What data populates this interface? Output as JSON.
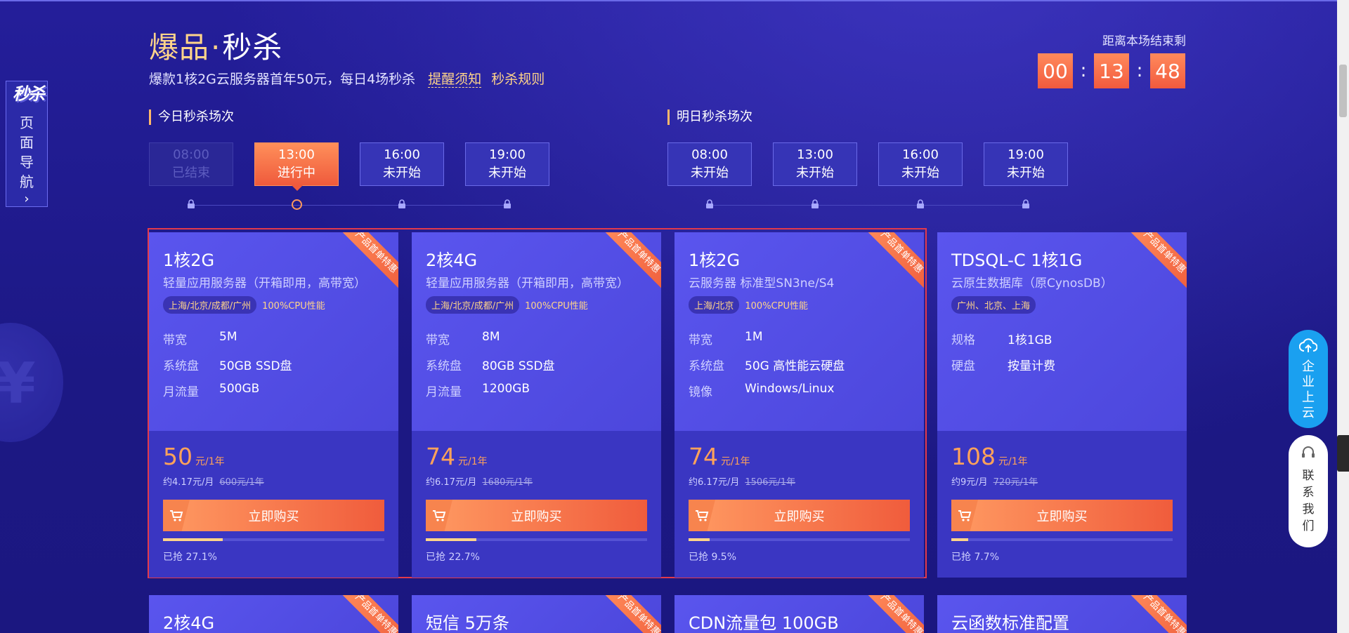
{
  "header": {
    "title_main": "爆品",
    "title_dot": "·",
    "title_sub": "秒杀",
    "subtitle": "爆款1核2G云服务器首年50元，每日4场秒杀",
    "link_remind": "提醒须知",
    "link_rules": "秒杀规则"
  },
  "side_nav": {
    "badge": "秒杀",
    "chars": [
      "页",
      "面",
      "导",
      "航"
    ],
    "chevron": "›"
  },
  "countdown": {
    "label": "距离本场结束剩",
    "hours": "00",
    "minutes": "13",
    "seconds": "48",
    "sep": ":"
  },
  "today": {
    "label": "今日秒杀场次",
    "sessions": [
      {
        "time": "08:00",
        "status": "已结束",
        "state": "ended"
      },
      {
        "time": "13:00",
        "status": "进行中",
        "state": "active"
      },
      {
        "time": "16:00",
        "status": "未开始",
        "state": "upcoming"
      },
      {
        "time": "19:00",
        "status": "未开始",
        "state": "upcoming"
      }
    ]
  },
  "tomorrow": {
    "label": "明日秒杀场次",
    "sessions": [
      {
        "time": "08:00",
        "status": "未开始",
        "state": "upcoming"
      },
      {
        "time": "13:00",
        "status": "未开始",
        "state": "upcoming"
      },
      {
        "time": "16:00",
        "status": "未开始",
        "state": "upcoming"
      },
      {
        "time": "19:00",
        "status": "未开始",
        "state": "upcoming"
      }
    ]
  },
  "products": [
    {
      "ribbon": "产品首单特惠",
      "name": "1核2G",
      "desc": "轻量应用服务器（开箱即用，高带宽）",
      "tag": "上海/北京/成都/广州",
      "tag2": "100%CPU性能",
      "specs": [
        [
          "带宽",
          "5M"
        ],
        [
          "系统盘",
          "50GB SSD盘"
        ],
        [
          "月流量",
          "500GB"
        ]
      ],
      "price": "50",
      "unit": "元/1年",
      "monthly": "约4.17元/月",
      "original": "600元/1年",
      "buy": "立即购买",
      "sold_label": "已抢 27.1%",
      "sold_pct": 27.1
    },
    {
      "ribbon": "产品首单特惠",
      "name": "2核4G",
      "desc": "轻量应用服务器（开箱即用，高带宽）",
      "tag": "上海/北京/成都/广州",
      "tag2": "100%CPU性能",
      "specs": [
        [
          "带宽",
          "8M"
        ],
        [
          "系统盘",
          "80GB SSD盘"
        ],
        [
          "月流量",
          "1200GB"
        ]
      ],
      "price": "74",
      "unit": "元/1年",
      "monthly": "约6.17元/月",
      "original": "1680元/1年",
      "buy": "立即购买",
      "sold_label": "已抢 22.7%",
      "sold_pct": 22.7
    },
    {
      "ribbon": "产品首单特惠",
      "name": "1核2G",
      "desc": "云服务器 标准型SN3ne/S4",
      "tag": "上海/北京",
      "tag2": "100%CPU性能",
      "specs": [
        [
          "带宽",
          "1M"
        ],
        [
          "系统盘",
          "50G 高性能云硬盘"
        ],
        [
          "镜像",
          "Windows/Linux"
        ]
      ],
      "price": "74",
      "unit": "元/1年",
      "monthly": "约6.17元/月",
      "original": "1506元/1年",
      "buy": "立即购买",
      "sold_label": "已抢 9.5%",
      "sold_pct": 9.5
    },
    {
      "ribbon": "产品首单特惠",
      "name": "TDSQL-C 1核1G",
      "desc": "云原生数据库（原CynosDB）",
      "tag": "广州、北京、上海",
      "tag2": "",
      "specs": [
        [
          "规格",
          "1核1GB"
        ],
        [
          "硬盘",
          "按量计费"
        ]
      ],
      "price": "108",
      "unit": "元/1年",
      "monthly": "约9元/月",
      "original": "720元/1年",
      "buy": "立即购买",
      "sold_label": "已抢 7.7%",
      "sold_pct": 7.7
    }
  ],
  "row2": [
    {
      "name": "2核4G",
      "ribbon": "产品首单特惠"
    },
    {
      "name": "短信 5万条",
      "ribbon": "产品首单特惠"
    },
    {
      "name": "CDN流量包 100GB",
      "ribbon": "产品首单特惠"
    },
    {
      "name": "云函数标准配置",
      "ribbon": "产品首单特惠"
    }
  ],
  "floats": {
    "enterprise": "企业上云",
    "contact": "联系我们"
  },
  "colors": {
    "accent": "#ffd48a",
    "orange": "#f25a3e",
    "bg": "#1e1a8c",
    "cloud_btn": "#1aa0f0"
  }
}
